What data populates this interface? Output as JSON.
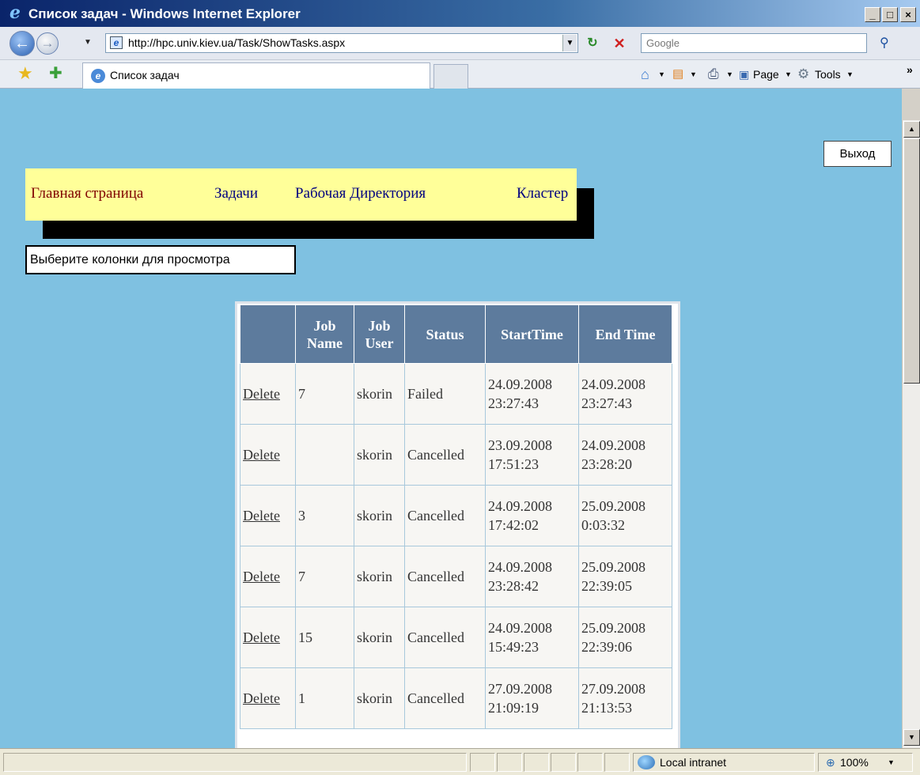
{
  "window": {
    "title": "Список задач - Windows Internet Explorer",
    "minimize": "_",
    "maximize": "□",
    "close": "×"
  },
  "navbar": {
    "url": "http://hpc.univ.kiev.ua/Task/ShowTasks.aspx",
    "search_placeholder": "Google"
  },
  "tabs": {
    "active_tab": "Список задач",
    "page_label": "Page",
    "tools_label": "Tools"
  },
  "page": {
    "logout_label": "Выход",
    "menu": [
      "Главная страница",
      "Задачи",
      "Рабочая Директория",
      "Кластер"
    ],
    "choose_columns_label": "Выберите колонки для просмотра"
  },
  "table": {
    "headers": [
      "",
      "Job Name",
      "Job User",
      "Status",
      "StartTime",
      "End Time"
    ],
    "rows": [
      {
        "action": "Delete",
        "job_name": "7",
        "job_user": "skorin",
        "status": "Failed",
        "start_date": "24.09.2008",
        "start_time": "23:27:43",
        "end_date": "24.09.2008",
        "end_time": "23:27:43"
      },
      {
        "action": "Delete",
        "job_name": "",
        "job_user": "skorin",
        "status": "Cancelled",
        "start_date": "23.09.2008",
        "start_time": "17:51:23",
        "end_date": "24.09.2008",
        "end_time": "23:28:20"
      },
      {
        "action": "Delete",
        "job_name": "3",
        "job_user": "skorin",
        "status": "Cancelled",
        "start_date": "24.09.2008",
        "start_time": "17:42:02",
        "end_date": "25.09.2008",
        "end_time": "0:03:32"
      },
      {
        "action": "Delete",
        "job_name": "7",
        "job_user": "skorin",
        "status": "Cancelled",
        "start_date": "24.09.2008",
        "start_time": "23:28:42",
        "end_date": "25.09.2008",
        "end_time": "22:39:05"
      },
      {
        "action": "Delete",
        "job_name": "15",
        "job_user": "skorin",
        "status": "Cancelled",
        "start_date": "24.09.2008",
        "start_time": "15:49:23",
        "end_date": "25.09.2008",
        "end_time": "22:39:06"
      },
      {
        "action": "Delete",
        "job_name": "1",
        "job_user": "skorin",
        "status": "Cancelled",
        "start_date": "27.09.2008",
        "start_time": "21:09:19",
        "end_date": "27.09.2008",
        "end_time": "21:13:53"
      }
    ]
  },
  "statusbar": {
    "zone": "Local intranet",
    "zoom": "100%"
  },
  "colors": {
    "page_background": "#7fc1e1",
    "menu_background": "#ffff99",
    "table_header": "#5d7b9d"
  }
}
